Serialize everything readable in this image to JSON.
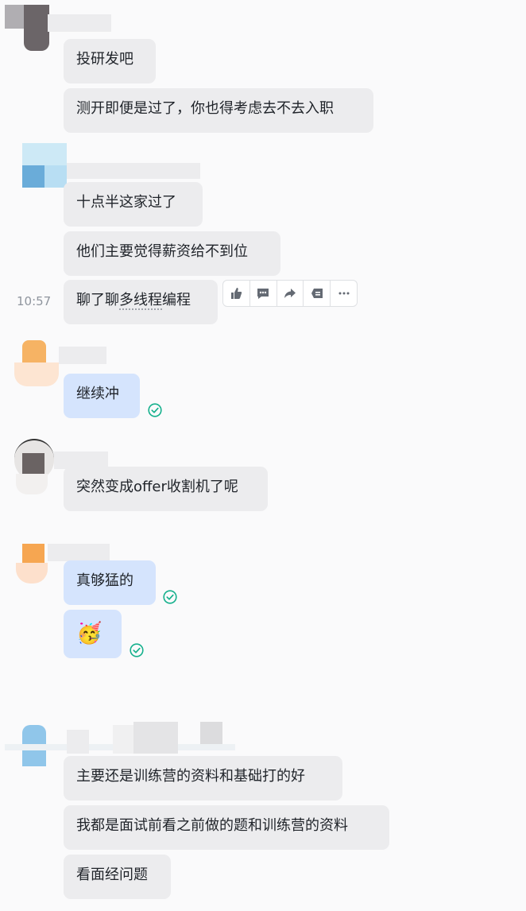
{
  "messages": {
    "m1": "投研发吧",
    "m2": "测开即便是过了，你也得考虑去不去入职",
    "m3": "十点半这家过了",
    "m4": "他们主要觉得薪资给不到位",
    "m5_prefix": "聊了聊",
    "m5_underlined": "多线程",
    "m5_suffix": "编程",
    "m6": "继续冲",
    "m7": "突然变成offer收割机了呢",
    "m8": "真够猛的",
    "m9_emoji": "🥳",
    "m10": "主要还是训练营的资料和基础打的好",
    "m11": "我都是面试前看之前做的题和训练营的资料",
    "m12": "看面经问题"
  },
  "timestamp": "10:57",
  "toolbar_icons": [
    "thumbs-up-icon",
    "comment-icon",
    "forward-icon",
    "pin-icon",
    "more-icon"
  ],
  "colors": {
    "bubble_other": "#ececee",
    "bubble_mine": "#d5e4fd",
    "read_check": "#14b08c",
    "background": "#fafafb"
  }
}
